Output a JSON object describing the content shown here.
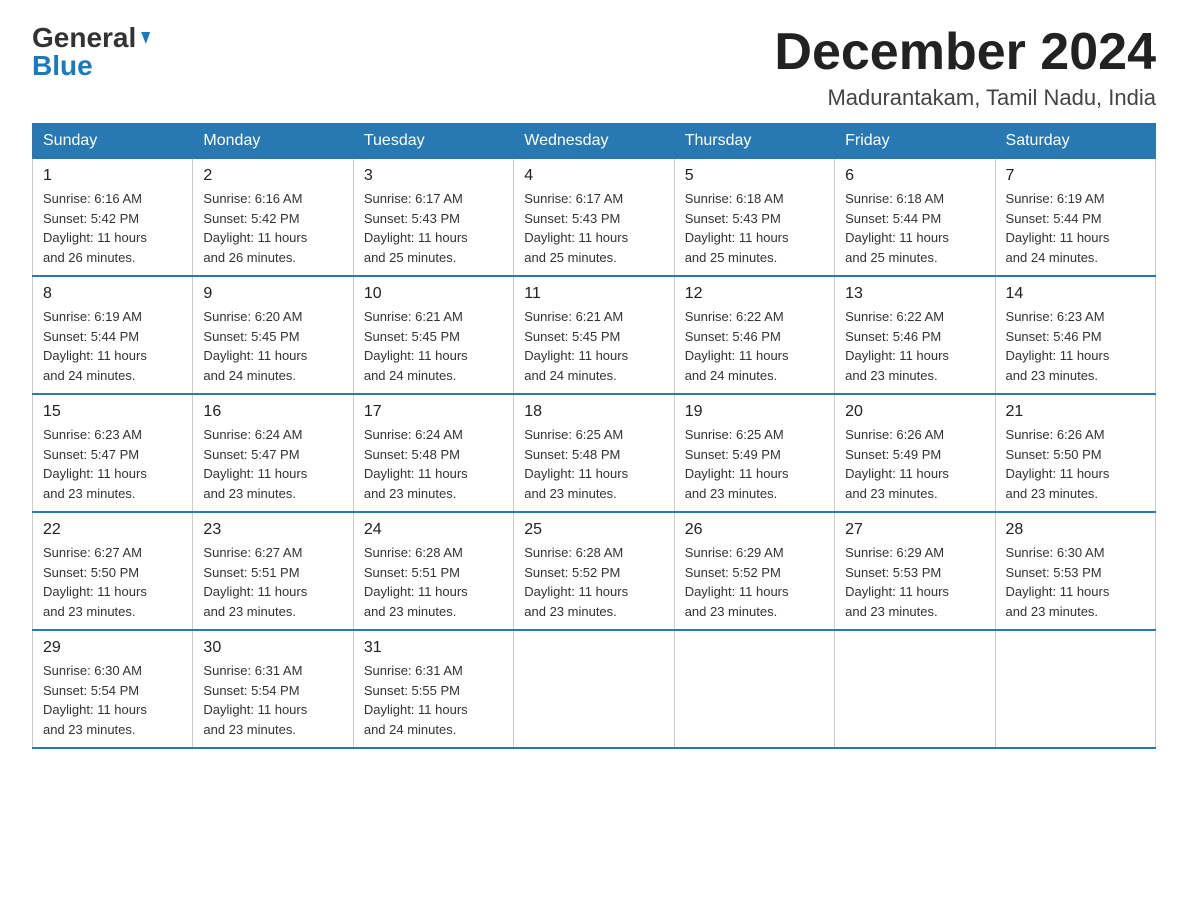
{
  "logo": {
    "general": "General",
    "blue": "Blue"
  },
  "title": "December 2024",
  "location": "Madurantakam, Tamil Nadu, India",
  "days_of_week": [
    "Sunday",
    "Monday",
    "Tuesday",
    "Wednesday",
    "Thursday",
    "Friday",
    "Saturday"
  ],
  "weeks": [
    [
      {
        "day": "1",
        "sunrise": "6:16 AM",
        "sunset": "5:42 PM",
        "daylight": "11 hours and 26 minutes."
      },
      {
        "day": "2",
        "sunrise": "6:16 AM",
        "sunset": "5:42 PM",
        "daylight": "11 hours and 26 minutes."
      },
      {
        "day": "3",
        "sunrise": "6:17 AM",
        "sunset": "5:43 PM",
        "daylight": "11 hours and 25 minutes."
      },
      {
        "day": "4",
        "sunrise": "6:17 AM",
        "sunset": "5:43 PM",
        "daylight": "11 hours and 25 minutes."
      },
      {
        "day": "5",
        "sunrise": "6:18 AM",
        "sunset": "5:43 PM",
        "daylight": "11 hours and 25 minutes."
      },
      {
        "day": "6",
        "sunrise": "6:18 AM",
        "sunset": "5:44 PM",
        "daylight": "11 hours and 25 minutes."
      },
      {
        "day": "7",
        "sunrise": "6:19 AM",
        "sunset": "5:44 PM",
        "daylight": "11 hours and 24 minutes."
      }
    ],
    [
      {
        "day": "8",
        "sunrise": "6:19 AM",
        "sunset": "5:44 PM",
        "daylight": "11 hours and 24 minutes."
      },
      {
        "day": "9",
        "sunrise": "6:20 AM",
        "sunset": "5:45 PM",
        "daylight": "11 hours and 24 minutes."
      },
      {
        "day": "10",
        "sunrise": "6:21 AM",
        "sunset": "5:45 PM",
        "daylight": "11 hours and 24 minutes."
      },
      {
        "day": "11",
        "sunrise": "6:21 AM",
        "sunset": "5:45 PM",
        "daylight": "11 hours and 24 minutes."
      },
      {
        "day": "12",
        "sunrise": "6:22 AM",
        "sunset": "5:46 PM",
        "daylight": "11 hours and 24 minutes."
      },
      {
        "day": "13",
        "sunrise": "6:22 AM",
        "sunset": "5:46 PM",
        "daylight": "11 hours and 23 minutes."
      },
      {
        "day": "14",
        "sunrise": "6:23 AM",
        "sunset": "5:46 PM",
        "daylight": "11 hours and 23 minutes."
      }
    ],
    [
      {
        "day": "15",
        "sunrise": "6:23 AM",
        "sunset": "5:47 PM",
        "daylight": "11 hours and 23 minutes."
      },
      {
        "day": "16",
        "sunrise": "6:24 AM",
        "sunset": "5:47 PM",
        "daylight": "11 hours and 23 minutes."
      },
      {
        "day": "17",
        "sunrise": "6:24 AM",
        "sunset": "5:48 PM",
        "daylight": "11 hours and 23 minutes."
      },
      {
        "day": "18",
        "sunrise": "6:25 AM",
        "sunset": "5:48 PM",
        "daylight": "11 hours and 23 minutes."
      },
      {
        "day": "19",
        "sunrise": "6:25 AM",
        "sunset": "5:49 PM",
        "daylight": "11 hours and 23 minutes."
      },
      {
        "day": "20",
        "sunrise": "6:26 AM",
        "sunset": "5:49 PM",
        "daylight": "11 hours and 23 minutes."
      },
      {
        "day": "21",
        "sunrise": "6:26 AM",
        "sunset": "5:50 PM",
        "daylight": "11 hours and 23 minutes."
      }
    ],
    [
      {
        "day": "22",
        "sunrise": "6:27 AM",
        "sunset": "5:50 PM",
        "daylight": "11 hours and 23 minutes."
      },
      {
        "day": "23",
        "sunrise": "6:27 AM",
        "sunset": "5:51 PM",
        "daylight": "11 hours and 23 minutes."
      },
      {
        "day": "24",
        "sunrise": "6:28 AM",
        "sunset": "5:51 PM",
        "daylight": "11 hours and 23 minutes."
      },
      {
        "day": "25",
        "sunrise": "6:28 AM",
        "sunset": "5:52 PM",
        "daylight": "11 hours and 23 minutes."
      },
      {
        "day": "26",
        "sunrise": "6:29 AM",
        "sunset": "5:52 PM",
        "daylight": "11 hours and 23 minutes."
      },
      {
        "day": "27",
        "sunrise": "6:29 AM",
        "sunset": "5:53 PM",
        "daylight": "11 hours and 23 minutes."
      },
      {
        "day": "28",
        "sunrise": "6:30 AM",
        "sunset": "5:53 PM",
        "daylight": "11 hours and 23 minutes."
      }
    ],
    [
      {
        "day": "29",
        "sunrise": "6:30 AM",
        "sunset": "5:54 PM",
        "daylight": "11 hours and 23 minutes."
      },
      {
        "day": "30",
        "sunrise": "6:31 AM",
        "sunset": "5:54 PM",
        "daylight": "11 hours and 23 minutes."
      },
      {
        "day": "31",
        "sunrise": "6:31 AM",
        "sunset": "5:55 PM",
        "daylight": "11 hours and 24 minutes."
      },
      null,
      null,
      null,
      null
    ]
  ],
  "labels": {
    "sunrise": "Sunrise:",
    "sunset": "Sunset:",
    "daylight": "Daylight:"
  }
}
